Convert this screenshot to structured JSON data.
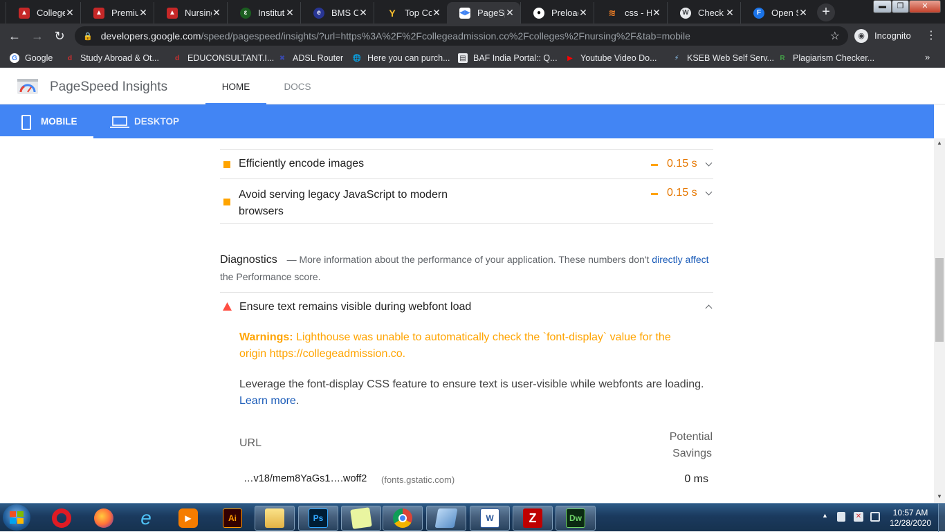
{
  "browser": {
    "tabs": [
      {
        "title": "College",
        "icon": "college-icon"
      },
      {
        "title": "Premiur",
        "icon": "college-icon"
      },
      {
        "title": "Nursing",
        "icon": "college-icon"
      },
      {
        "title": "Instituti",
        "icon": "institution-icon"
      },
      {
        "title": "BMS Co",
        "icon": "bms-icon"
      },
      {
        "title": "Top Col",
        "icon": "top-college-icon"
      },
      {
        "title": "PageSp",
        "icon": "pagespeed-icon"
      },
      {
        "title": "Preload",
        "icon": "github-icon"
      },
      {
        "title": "css - Ho",
        "icon": "stackoverflow-icon"
      },
      {
        "title": "Check t",
        "icon": "wordpress-icon"
      },
      {
        "title": "Open S",
        "icon": "letter-f-icon"
      }
    ],
    "url_host": "developers.google.com",
    "url_path": "/speed/pagespeed/insights/?url=https%3A%2F%2Fcollegeadmission.co%2Fcolleges%2Fnursing%2F&tab=mobile",
    "incognito_label": "Incognito",
    "bookmarks": [
      {
        "label": "Google"
      },
      {
        "label": "Study Abroad & Ot..."
      },
      {
        "label": "EDUCONSULTANT.I..."
      },
      {
        "label": "ADSL Router"
      },
      {
        "label": "Here you can purch..."
      },
      {
        "label": "BAF India Portal:: Q..."
      },
      {
        "label": "Youtube Video Do..."
      },
      {
        "label": "KSEB Web Self Serv..."
      },
      {
        "label": "Plagiarism Checker..."
      }
    ]
  },
  "pagespeed": {
    "brand": "PageSpeed Insights",
    "nav": {
      "home": "HOME",
      "docs": "DOCS"
    },
    "device_tabs": {
      "mobile": "MOBILE",
      "desktop": "DESKTOP"
    },
    "opportunities": [
      {
        "title": "Efficiently encode images",
        "savings": "0.15 s"
      },
      {
        "title_line1": "Avoid serving legacy JavaScript to modern",
        "title_line2": "browsers",
        "savings": "0.15 s"
      }
    ],
    "diagnostics": {
      "heading": "Diagnostics",
      "desc_pre": "— More information about the performance of your application. These numbers don't",
      "desc_link1": "directly",
      "desc_link2": "affect",
      "desc_post": "the Performance score."
    },
    "audit": {
      "title": "Ensure text remains visible during webfont load",
      "warning_label": "Warnings:",
      "warning_line1": "Lighthouse was unable to automatically check the `font-display` value for the",
      "warning_line2": "origin https://collegeadmission.co.",
      "desc": "Leverage the font-display CSS feature to ensure text is user-visible while webfonts are loading.",
      "learn_more": "Learn more",
      "learn_more_end": ".",
      "table": {
        "col_url": "URL",
        "col_savings_line1": "Potential",
        "col_savings_line2": "Savings",
        "rows": [
          {
            "url": "…v18/mem8YaGs1….woff2",
            "host": "(fonts.gstatic.com)",
            "savings": "0 ms"
          }
        ]
      }
    }
  },
  "taskbar": {
    "time": "10:57 AM",
    "date": "12/28/2020",
    "apps": [
      {
        "name": "opera-icon"
      },
      {
        "name": "firefox-icon"
      },
      {
        "name": "internet-explorer-icon"
      },
      {
        "name": "media-player-icon"
      },
      {
        "name": "illustrator-icon",
        "label": "Ai"
      },
      {
        "name": "file-explorer-icon"
      },
      {
        "name": "photoshop-icon",
        "label": "Ps"
      },
      {
        "name": "sticky-notes-icon"
      },
      {
        "name": "chrome-icon"
      },
      {
        "name": "notepad-icon"
      },
      {
        "name": "word-icon",
        "label": "W"
      },
      {
        "name": "filezilla-icon",
        "label": "Z"
      },
      {
        "name": "dreamweaver-icon",
        "label": "Dw"
      }
    ]
  },
  "colors": {
    "accent_blue": "#4285f4",
    "warning_orange": "#ffa400",
    "savings_text": "#e67700",
    "fail_red": "#ff4e42",
    "link_blue": "#1a5bb8"
  }
}
